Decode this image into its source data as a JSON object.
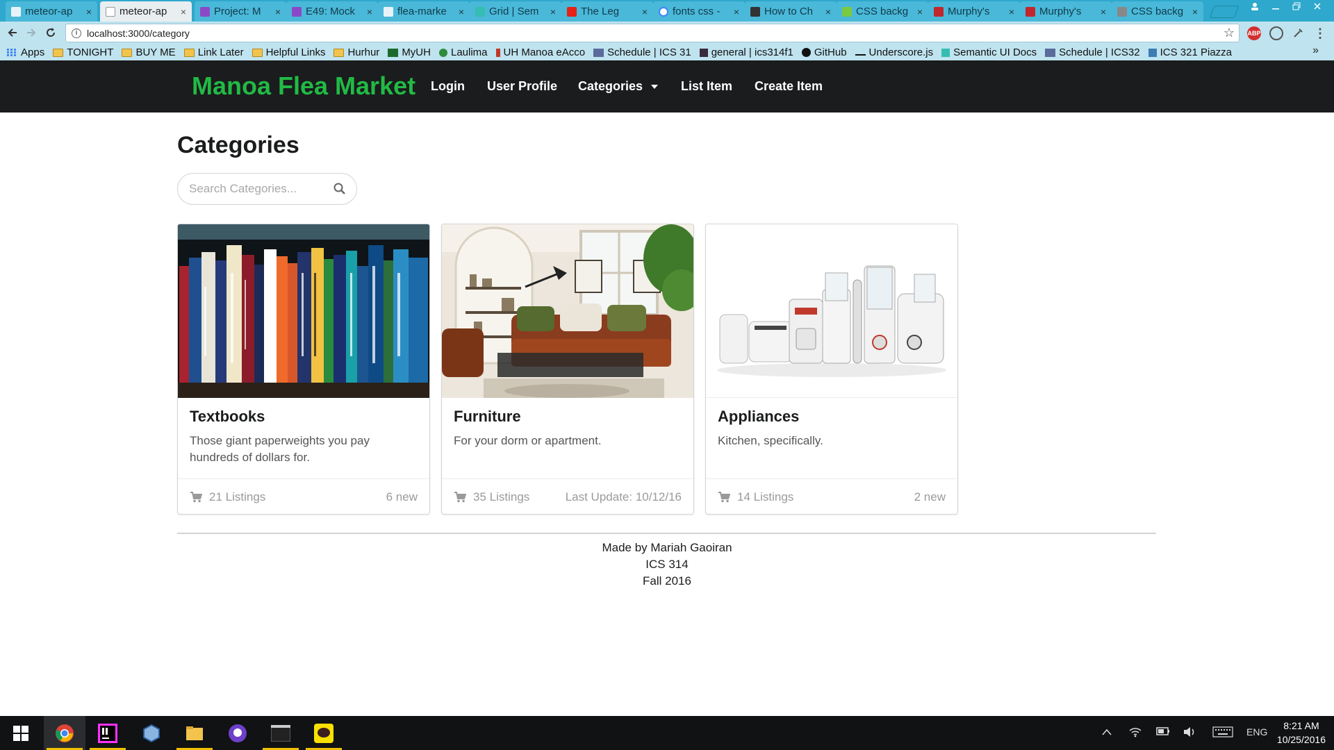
{
  "browser": {
    "tabs": [
      {
        "title": "meteor-ap",
        "color": "#6fb6d2"
      },
      {
        "title": "meteor-ap",
        "color": "#6fb6d2"
      },
      {
        "title": "Project: M",
        "color": "#8a4ac7"
      },
      {
        "title": "E49: Mock",
        "color": "#8a4ac7"
      },
      {
        "title": "flea-marke",
        "color": "#6fb6d2"
      },
      {
        "title": "Grid | Sem",
        "color": "#35bdb2"
      },
      {
        "title": "The Leg",
        "color": "#e62117"
      },
      {
        "title": "fonts css -",
        "color": "#ffffff"
      },
      {
        "title": "How to Ch",
        "color": "#333333"
      },
      {
        "title": "CSS backg",
        "color": "#7ac943"
      },
      {
        "title": "Murphy's",
        "color": "#c1272d"
      },
      {
        "title": "Murphy's",
        "color": "#c1272d"
      },
      {
        "title": "CSS backg",
        "color": "#888888"
      }
    ],
    "close_glyph": "×",
    "url": "localhost:3000/category",
    "bookmarks": [
      {
        "label": "Apps",
        "icon": "apps-icon"
      },
      {
        "label": "TONIGHT",
        "icon": "folder-icon"
      },
      {
        "label": "BUY ME",
        "icon": "folder-icon"
      },
      {
        "label": "Link Later",
        "icon": "folder-icon"
      },
      {
        "label": "Helpful Links",
        "icon": "folder-icon"
      },
      {
        "label": "Hurhur",
        "icon": "folder-icon"
      },
      {
        "label": "MyUH",
        "icon": "uh-icon"
      },
      {
        "label": "Laulima",
        "icon": "laulima-icon"
      },
      {
        "label": "UH Manoa eAcco",
        "icon": "uh-icon"
      },
      {
        "label": "Schedule | ICS 31",
        "icon": "page-icon"
      },
      {
        "label": "general | ics314f1",
        "icon": "slack-icon"
      },
      {
        "label": "GitHub",
        "icon": "github-icon"
      },
      {
        "label": "Underscore.js",
        "icon": "underscore-icon"
      },
      {
        "label": "Semantic UI Docs",
        "icon": "semantic-icon"
      },
      {
        "label": "Schedule | ICS32",
        "icon": "page-icon"
      },
      {
        "label": "ICS 321 Piazza",
        "icon": "piazza-icon"
      }
    ],
    "more_glyph": "»"
  },
  "nav": {
    "brand": "Manoa Flea Market",
    "items": [
      "Login",
      "User Profile",
      "Categories",
      "List Item",
      "Create Item"
    ],
    "brand_color": "#21ba45"
  },
  "page": {
    "title": "Categories",
    "search_placeholder": "Search Categories..."
  },
  "cards": [
    {
      "name": "Textbooks",
      "desc": "Those giant paperweights you pay hundreds of dollars for.",
      "listings": "21 Listings",
      "meta": "6 new",
      "image": "bookshelf"
    },
    {
      "name": "Furniture",
      "desc": "For your dorm or apartment.",
      "listings": "35 Listings",
      "meta": "Last Update: 10/12/16",
      "image": "living-room"
    },
    {
      "name": "Appliances",
      "desc": "Kitchen, specifically.",
      "listings": "14 Listings",
      "meta": "2 new",
      "image": "kitchen-appliances"
    }
  ],
  "footer": {
    "line1": "Made by Mariah Gaoiran",
    "line2": "ICS 314",
    "line3": "Fall 2016"
  },
  "taskbar": {
    "lang": "ENG",
    "time": "8:21 AM",
    "date": "10/25/2016",
    "apps": [
      "windows-start-icon",
      "chrome-icon",
      "intellij-icon",
      "virtualbox-icon",
      "file-explorer-icon",
      "github-desktop-icon",
      "terminal-icon",
      "kakaotalk-icon"
    ]
  }
}
